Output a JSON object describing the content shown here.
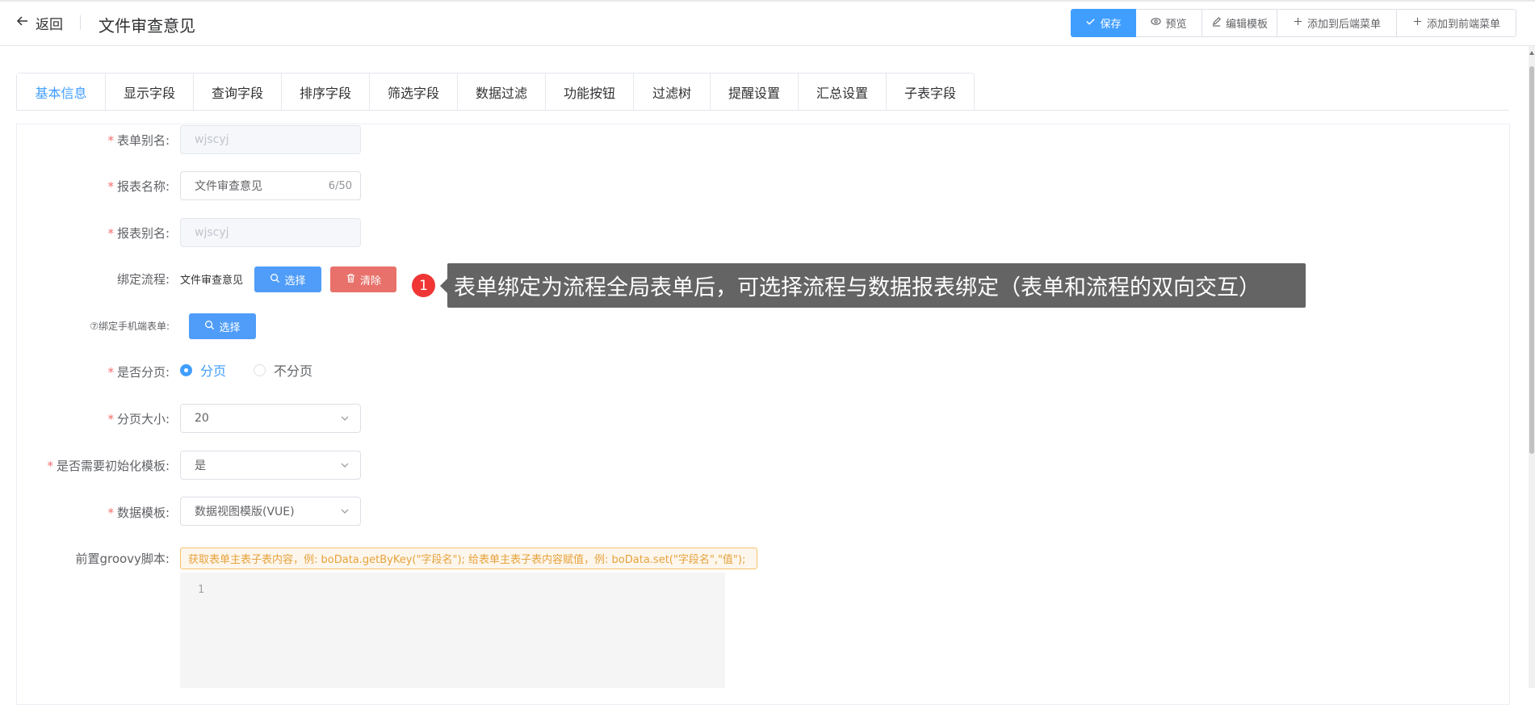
{
  "header": {
    "back_label": "返回",
    "title": "文件审查意见",
    "buttons": {
      "save": "保存",
      "preview": "预览",
      "edit_template": "编辑模板",
      "add_backend_menu": "添加到后端菜单",
      "add_frontend_menu": "添加到前端菜单"
    }
  },
  "tabs": [
    "基本信息",
    "显示字段",
    "查询字段",
    "排序字段",
    "筛选字段",
    "数据过滤",
    "功能按钮",
    "过滤树",
    "提醒设置",
    "汇总设置",
    "子表字段"
  ],
  "form": {
    "form_alias": {
      "label": "表单别名:",
      "value": "wjscyj"
    },
    "report_name": {
      "label": "报表名称:",
      "value": "文件审查意见",
      "counter": "6/50"
    },
    "report_alias": {
      "label": "报表别名:",
      "value": "wjscyj"
    },
    "bind_flow": {
      "label": "绑定流程:",
      "value": "文件审查意见",
      "select_label": "选择",
      "clear_label": "清除"
    },
    "bind_mobile": {
      "label": "⑦绑定手机端表单:",
      "select_label": "选择"
    },
    "paging": {
      "label": "是否分页:",
      "option_on": "分页",
      "option_off": "不分页",
      "selected": "分页"
    },
    "page_size": {
      "label": "分页大小:",
      "value": "20"
    },
    "init_template": {
      "label": "是否需要初始化模板:",
      "value": "是"
    },
    "data_template": {
      "label": "数据模板:",
      "value": "数据视图模版(VUE)"
    },
    "groovy": {
      "label": "前置groovy脚本:",
      "hint": "获取表单主表子表内容，例: boData.getByKey(\"字段名\"); 给表单主表子表内容赋值，例: boData.set(\"字段名\",\"值\");",
      "line_number": "1"
    }
  },
  "callout": {
    "badge": "1",
    "text": "表单绑定为流程全局表单后，可选择流程与数据报表绑定（表单和流程的双向交互）"
  },
  "colors": {
    "primary": "#409eff",
    "danger": "#e8716b",
    "required": "#f56c6c",
    "warning": "#e6a23c"
  }
}
